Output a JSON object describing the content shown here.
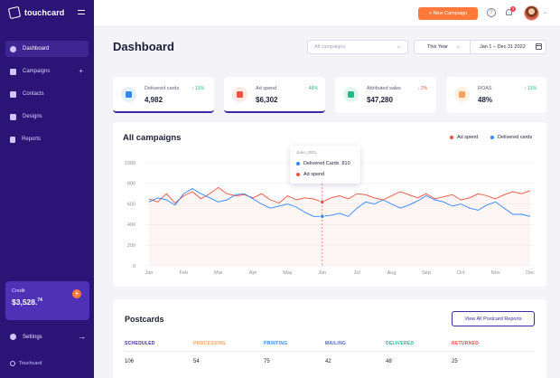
{
  "app": {
    "brand": "touchcard"
  },
  "sidebar": {
    "items": [
      {
        "label": "Dashboard",
        "icon": "pie-chart-icon"
      },
      {
        "label": "Campaigns",
        "icon": "megaphone-icon"
      },
      {
        "label": "Contacts",
        "icon": "contacts-icon"
      },
      {
        "label": "Designs",
        "icon": "designs-icon"
      },
      {
        "label": "Reports",
        "icon": "bar-chart-icon"
      }
    ],
    "credit": {
      "label": "Credit",
      "amount": "$3,528.",
      "cents": "74"
    },
    "settings_label": "Settings",
    "footer": "Touchcard"
  },
  "topbar": {
    "new_campaign": "+ New Campaign",
    "help": "?",
    "notifications": "3"
  },
  "header": {
    "title": "Dashboard",
    "campaign_filter": "All campaigns",
    "period": "This Year",
    "date_range": "Jan 1 – Dec 31 2022"
  },
  "stats": [
    {
      "label": "Delivered cards",
      "value": "4,982",
      "delta": "↑ 13%",
      "icon": "postcard-icon",
      "color": "#2f86ff",
      "tint": "#e5f0ff",
      "trend": "up"
    },
    {
      "label": "Ad spend",
      "value": "$6,302",
      "delta": "↑ 48%",
      "icon": "money-icon",
      "color": "#f0503c",
      "tint": "#ffe9e6",
      "trend": "up"
    },
    {
      "label": "Attributed sales",
      "value": "$47,280",
      "delta": "↓ 2%",
      "icon": "sales-icon",
      "color": "#21b98a",
      "tint": "#e3f7ef",
      "trend": "down"
    },
    {
      "label": "ROAS",
      "value": "48%",
      "delta": "↑ 13%",
      "icon": "roas-icon",
      "color": "#f5a25c",
      "tint": "#fff1e4",
      "trend": "up"
    }
  ],
  "chart_data": {
    "type": "line",
    "title": "All campaigns",
    "categories": [
      "Jan",
      "Feb",
      "Mar",
      "Apr",
      "May",
      "Jun",
      "Jul",
      "Aug",
      "Sep",
      "Oct",
      "Nov",
      "Dec"
    ],
    "x": [
      1,
      1.25,
      1.5,
      1.75,
      2,
      2.25,
      2.5,
      2.75,
      3,
      3.25,
      3.5,
      3.75,
      4,
      4.25,
      4.5,
      4.75,
      5,
      5.25,
      5.5,
      5.75,
      6,
      6.25,
      6.5,
      6.75,
      7,
      7.25,
      7.5,
      7.75,
      8,
      8.25,
      8.5,
      8.75,
      9,
      9.25,
      9.5,
      9.75,
      10,
      10.25,
      10.5,
      10.75,
      11,
      11.25,
      11.5,
      11.75,
      12
    ],
    "series": [
      {
        "name": "Ad spend",
        "color": "#f0503c",
        "values": [
          650,
          620,
          700,
          610,
          680,
          720,
          650,
          700,
          760,
          700,
          680,
          690,
          660,
          700,
          640,
          610,
          680,
          640,
          660,
          650,
          620,
          660,
          680,
          650,
          700,
          690,
          660,
          640,
          680,
          720,
          690,
          660,
          700,
          650,
          670,
          690,
          640,
          660,
          700,
          680,
          650,
          690,
          720,
          700,
          730
        ]
      },
      {
        "name": "Delivered cards",
        "color": "#2f86ff",
        "values": [
          620,
          660,
          640,
          590,
          700,
          750,
          700,
          660,
          620,
          640,
          690,
          700,
          650,
          600,
          560,
          580,
          600,
          570,
          520,
          480,
          480,
          490,
          510,
          480,
          560,
          620,
          600,
          640,
          600,
          560,
          590,
          630,
          680,
          640,
          620,
          580,
          600,
          560,
          540,
          590,
          620,
          560,
          500,
          500,
          480
        ]
      }
    ],
    "ylim": [
      0,
      1000
    ],
    "yticks": [
      0,
      200,
      400,
      600,
      800,
      1000
    ],
    "grid": true,
    "legend": "top-right",
    "tooltip": {
      "date": "June, 2021",
      "rows": [
        {
          "label": "Delivered Cards",
          "value": "810",
          "color": "#2f86ff"
        },
        {
          "label": "Ad spend",
          "value": "",
          "color": "#f0503c"
        }
      ]
    }
  },
  "postcards": {
    "title": "Postcards",
    "button": "View All Postcard Reports",
    "columns": [
      {
        "label": "SCHEDULED",
        "value": "106",
        "color": "#3b2aa3"
      },
      {
        "label": "PROCESSING",
        "value": "54",
        "color": "#f5a25c"
      },
      {
        "label": "PRINTING",
        "value": "75",
        "color": "#2f86ff"
      },
      {
        "label": "MAILING",
        "value": "42",
        "color": "#4b62d6"
      },
      {
        "label": "DELIVERED",
        "value": "48",
        "color": "#21b98a"
      },
      {
        "label": "RETURNED",
        "value": "25",
        "color": "#f0503c"
      }
    ]
  }
}
